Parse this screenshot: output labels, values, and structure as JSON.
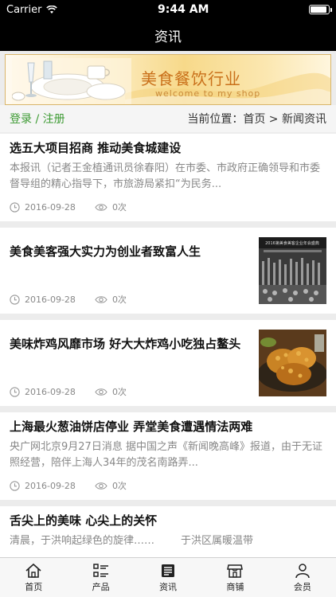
{
  "status": {
    "carrier": "Carrier",
    "time": "9:44 AM"
  },
  "nav": {
    "title": "资讯"
  },
  "banner": {
    "title": "美食餐饮行业",
    "subtitle": "welcome to my shop"
  },
  "location": {
    "login": "登录 / 注册",
    "position": "当前位置：首页 > 新闻资讯"
  },
  "articles": [
    {
      "title": "选五大项目招商 推动美食城建设",
      "desc": "本报讯（记者王金植通讯员徐春阳）在市委、市政府正确领导和市委督导组的精心指导下，市旅游局紧扣“为民务...",
      "date": "2016-09-28",
      "views": "0次"
    },
    {
      "title": "美食美客强大实力为创业者致富人生",
      "date": "2016-09-28",
      "views": "0次",
      "thumb": "banquet-photo",
      "thumb_caption": "2016第美食美客企业年会盛典"
    },
    {
      "title": "美味炸鸡风靡市场 好大大炸鸡小吃独占鳌头",
      "date": "2016-09-28",
      "views": "0次",
      "thumb": "fried-chicken-photo"
    },
    {
      "title": "上海最火葱油饼店停业 弄堂美食遭遇情法两难",
      "desc": "央广网北京9月27日消息 据中国之声《新闻晚高峰》报道，由于无证照经营，陪伴上海人34年的茂名南路弄...",
      "date": "2016-09-28",
      "views": "0次"
    },
    {
      "title": "舌尖上的美味 心尖上的关怀",
      "desc": "清晨，于洪响起绿色的旋律……        于洪区属暖温带"
    }
  ],
  "tabs": [
    {
      "label": "首页",
      "icon": "home-icon"
    },
    {
      "label": "产品",
      "icon": "list-icon"
    },
    {
      "label": "资讯",
      "icon": "news-icon"
    },
    {
      "label": "商铺",
      "icon": "store-icon"
    },
    {
      "label": "会员",
      "icon": "user-icon"
    }
  ],
  "colors": {
    "accent_green": "#3c9a32",
    "banner_orange": "#c9701a",
    "bar_black": "#000000"
  }
}
